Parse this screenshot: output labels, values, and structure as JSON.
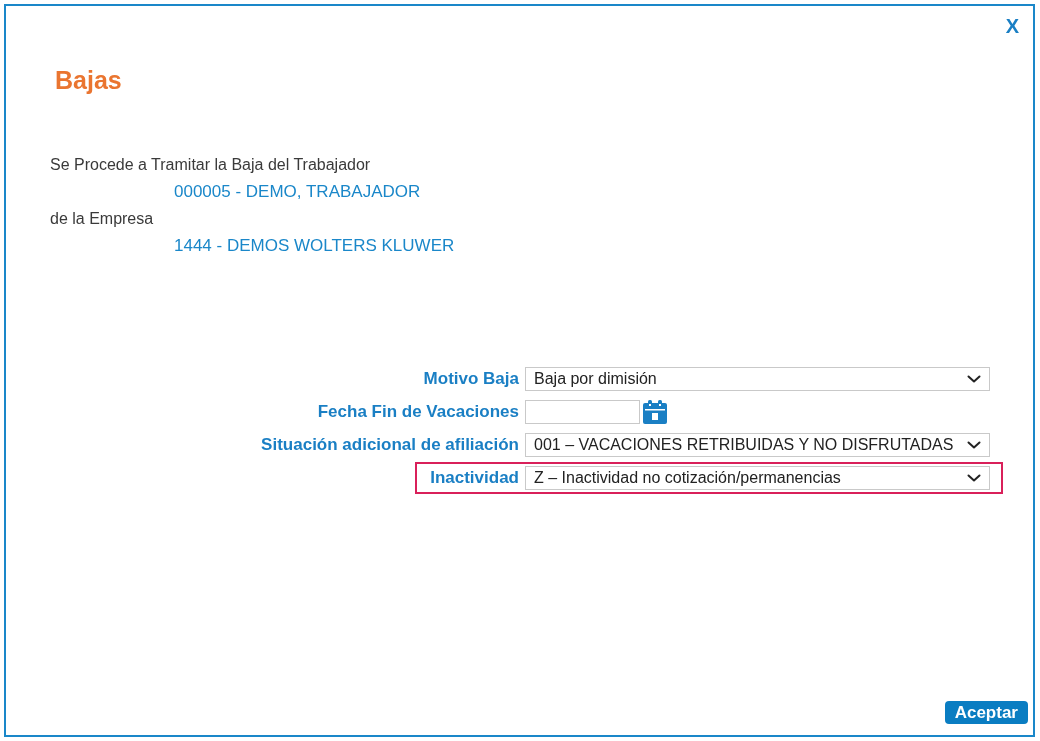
{
  "dialog": {
    "title": "Bajas",
    "close": "X"
  },
  "intro": [
    {
      "kind": "text",
      "text": "Se Procede a Tramitar la Baja del Trabajador"
    },
    {
      "kind": "value",
      "text": "000005 - DEMO, TRABAJADOR"
    },
    {
      "kind": "text",
      "text": "de la Empresa"
    },
    {
      "kind": "value",
      "text": "1444 - DEMOS WOLTERS KLUWER"
    }
  ],
  "fields": [
    {
      "label": "Motivo Baja",
      "kind": "select",
      "value": "Baja por dimisión",
      "highlighted": false
    },
    {
      "label": "Fecha Fin de Vacaciones",
      "kind": "date",
      "highlighted": false
    },
    {
      "label": "Situación adicional de afiliación",
      "kind": "select",
      "value": "001 – VACACIONES RETRIBUIDAS Y NO DISFRUTADAS",
      "highlighted": false
    },
    {
      "label": "Inactividad",
      "kind": "select",
      "value": "Z – Inactividad no cotización/permanencias",
      "highlighted": true
    }
  ],
  "buttons": [
    {
      "label": "Aceptar"
    }
  ]
}
